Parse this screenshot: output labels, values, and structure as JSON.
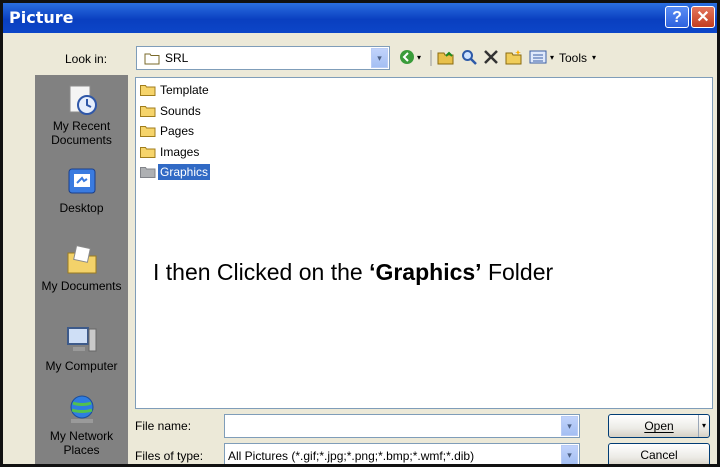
{
  "window": {
    "title": "Picture",
    "help_label": "?",
    "close_label": "✕"
  },
  "lookin": {
    "label": "Look in:",
    "value": "SRL",
    "dropdown_glyph": "▾"
  },
  "toolbar": {
    "tools_label": "Tools",
    "caret": "▾"
  },
  "places": [
    {
      "line1": "My Recent",
      "line2": "Documents",
      "icon": "recent-documents-icon"
    },
    {
      "line1": "Desktop",
      "line2": "",
      "icon": "desktop-icon"
    },
    {
      "line1": "My Documents",
      "line2": "",
      "icon": "my-documents-icon"
    },
    {
      "line1": "My Computer",
      "line2": "",
      "icon": "my-computer-icon"
    },
    {
      "line1": "My Network",
      "line2": "Places",
      "icon": "network-places-icon"
    }
  ],
  "folders": [
    {
      "name": "Template",
      "selected": false
    },
    {
      "name": "Sounds",
      "selected": false
    },
    {
      "name": "Pages",
      "selected": false
    },
    {
      "name": "Images",
      "selected": false
    },
    {
      "name": "Graphics",
      "selected": true
    }
  ],
  "caption": {
    "before": "I then Clicked on the ",
    "bold": "‘Graphics’",
    "after": " Folder"
  },
  "filename": {
    "label": "File name:",
    "value": ""
  },
  "filetype": {
    "label": "Files of type:",
    "value": "All Pictures (*.gif;*.jpg;*.png;*.bmp;*.wmf;*.dib)"
  },
  "buttons": {
    "open": "Open",
    "cancel": "Cancel"
  }
}
